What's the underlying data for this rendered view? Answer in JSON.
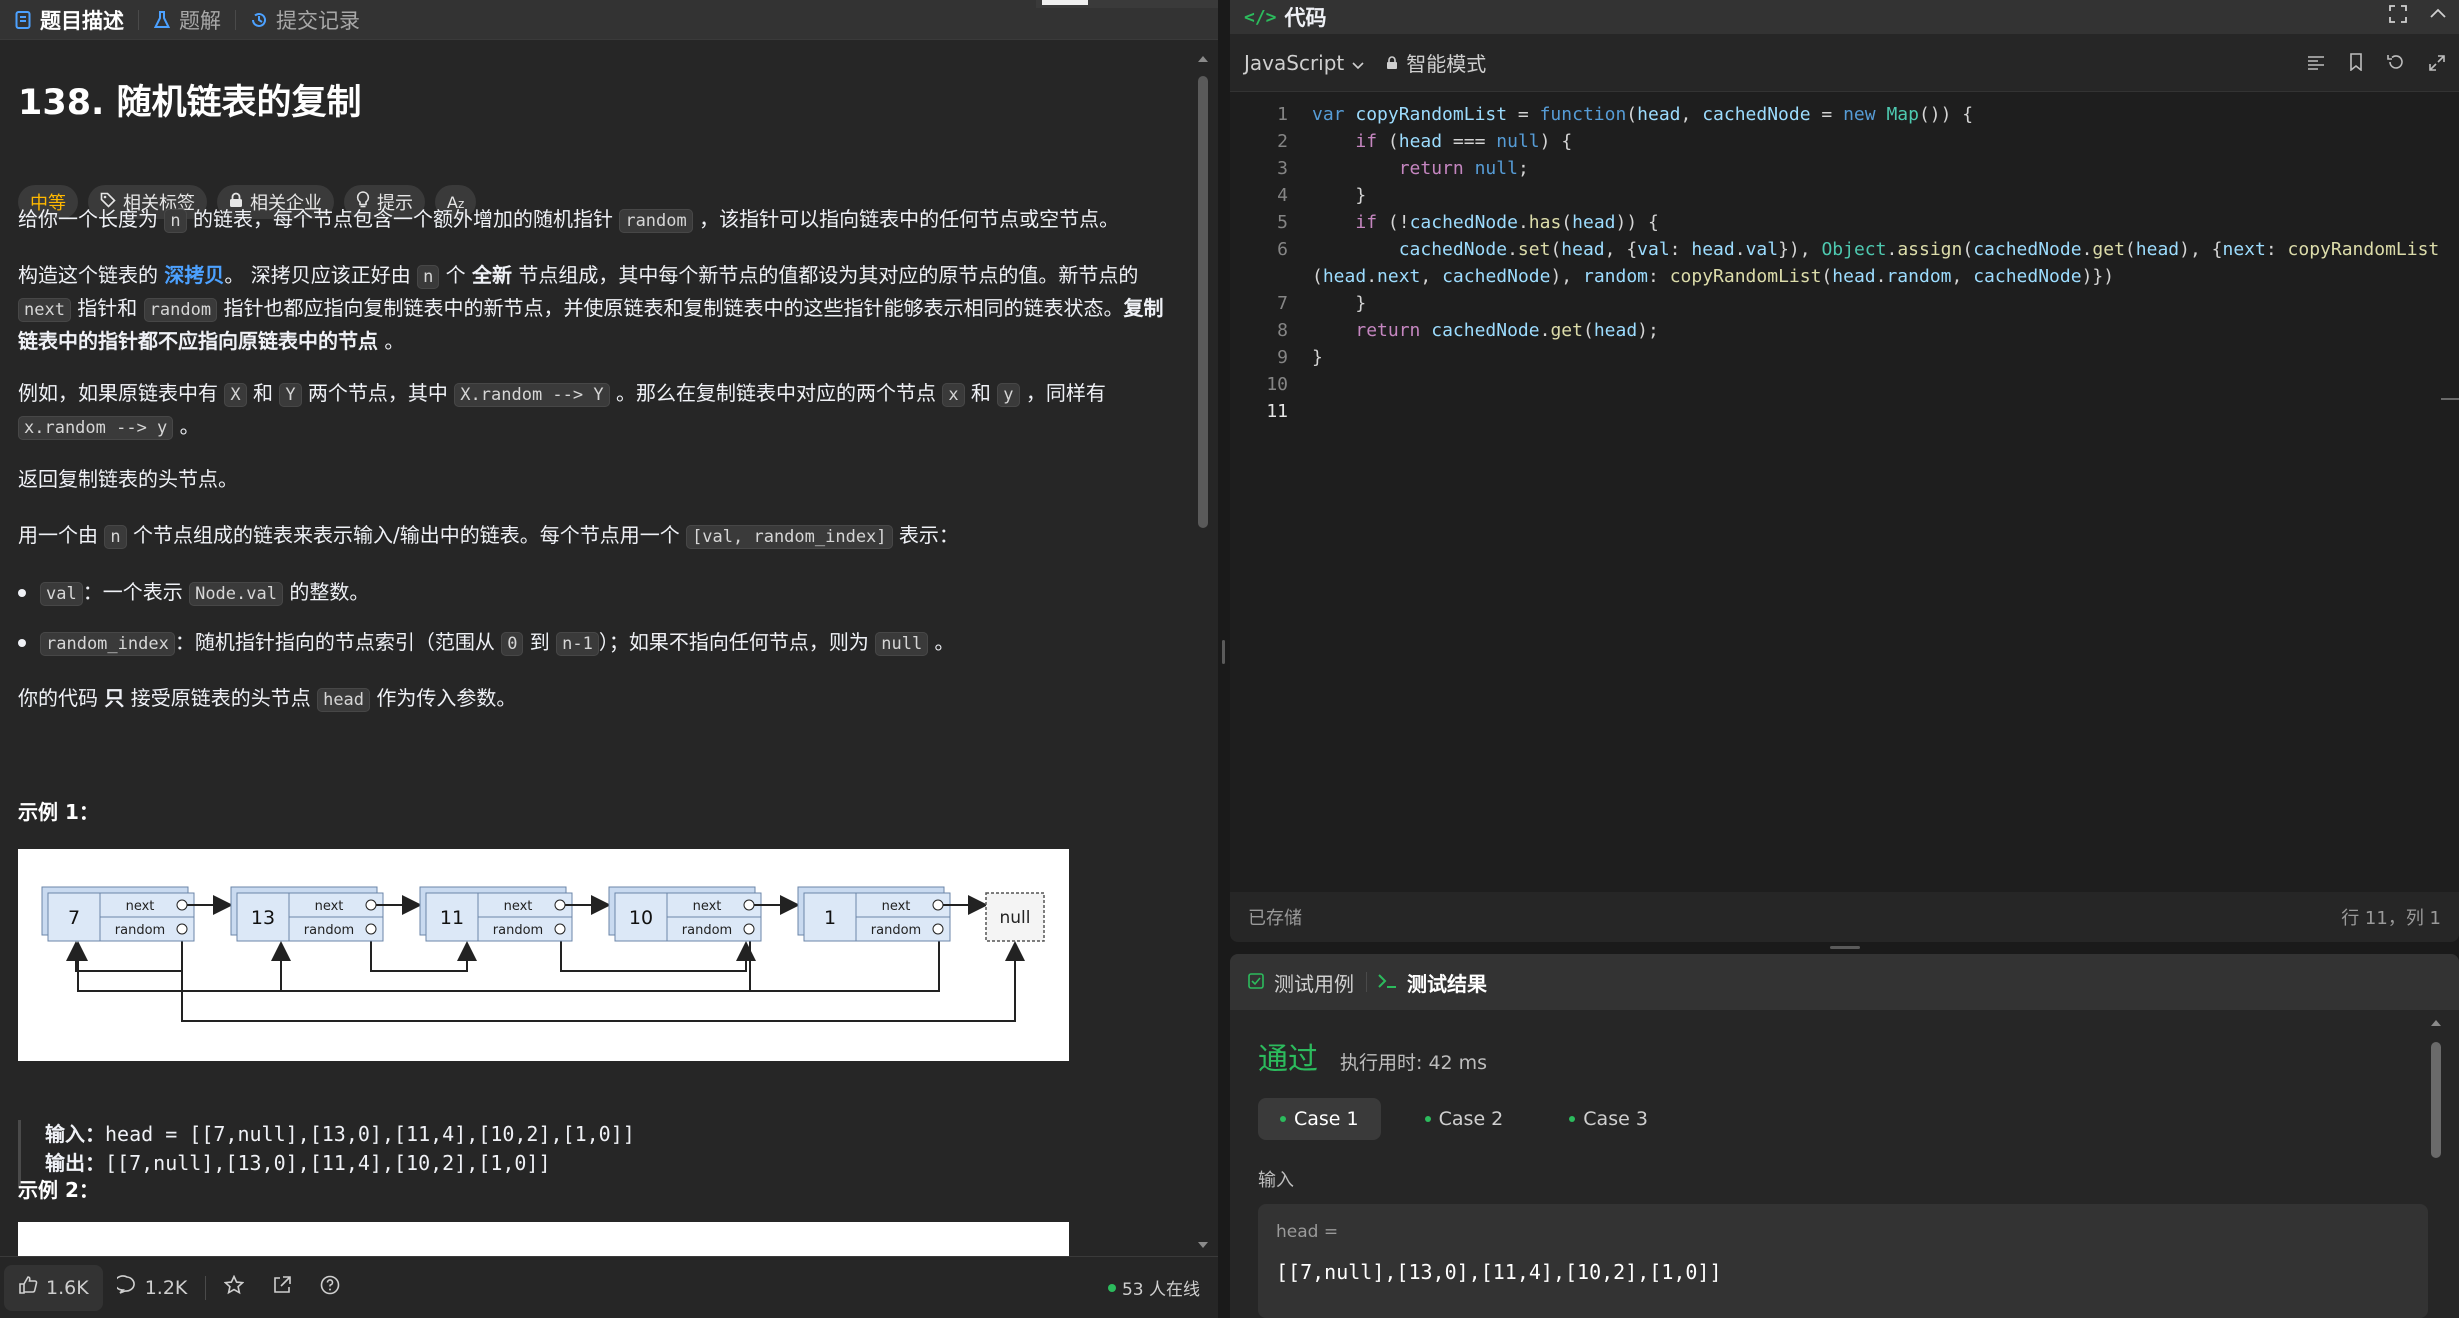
{
  "left_tabs": [
    {
      "label": "题目描述",
      "icon": "doc-icon",
      "color": "#4ca1ff"
    },
    {
      "label": "题解",
      "icon": "flask-icon",
      "color": "#4ca1ff"
    },
    {
      "label": "提交记录",
      "icon": "history-icon",
      "color": "#4ca1ff"
    }
  ],
  "problem": {
    "title": "138. 随机链表的复制",
    "chips": [
      {
        "label": "中等",
        "icon": ""
      },
      {
        "label": "相关标签",
        "icon": "tag-icon"
      },
      {
        "label": "相关企业",
        "icon": "lock-icon"
      },
      {
        "label": "提示",
        "icon": "bulb-icon"
      },
      {
        "label": "",
        "icon": "translate-icon"
      }
    ],
    "p1": {
      "a": "给你一个长度为 ",
      "b": "n",
      "c": " 的链表，每个节点包含一个额外增加的随机指针 ",
      "d": "random",
      "e": " ，该指针可以指向链表中的任何节点或空节点。"
    },
    "p2": {
      "a": "构造这个链表的 ",
      "link": "深拷贝",
      "b": "。 深拷贝应该正好由 ",
      "c": "n",
      "d": " 个 ",
      "e": "全新",
      "f": " 节点组成，其中每个新节点的值都设为其对应的原节点的值。新节点的 ",
      "g": "next",
      "h": " 指针和 ",
      "i": "random",
      "j": " 指针也都应指向复制链表中的新节点，并使原链表和复制链表中的这些指针能够表示相同的链表状态。",
      "k": "复制链表中的指针都不应指向原链表中的节点",
      "l": " 。"
    },
    "p3": {
      "a": "例如，如果原链表中有 ",
      "b": "X",
      "c": " 和 ",
      "d": "Y",
      "e": " 两个节点，其中 ",
      "f": "X.random --> Y",
      "g": " 。那么在复制链表中对应的两个节点 ",
      "h": "x",
      "i": " 和 ",
      "j": "y",
      "k": " ，同样有 ",
      "l": "x.random --> y",
      "m": " 。"
    },
    "p4": "返回复制链表的头节点。",
    "p5": {
      "a": "用一个由 ",
      "b": "n",
      "c": " 个节点组成的链表来表示输入/输出中的链表。每个节点用一个 ",
      "d": "[val, random_index]",
      "e": " 表示："
    },
    "bullet1": {
      "a": "val",
      "b": "：一个表示 ",
      "c": "Node.val",
      "d": " 的整数。"
    },
    "bullet2": {
      "a": "random_index",
      "b": "：随机指针指向的节点索引（范围从 ",
      "c": "0",
      "d": " 到 ",
      "e": "n-1",
      "f": "）；如果不指向任何节点，则为  ",
      "g": "null",
      "h": " 。"
    },
    "p6": {
      "a": "你的代码 ",
      "b": "只",
      "c": " 接受原链表的头节点 ",
      "d": "head",
      "e": " 作为传入参数。"
    },
    "example1": {
      "title": "示例 1：",
      "diagram": {
        "nodes": [
          "7",
          "13",
          "11",
          "10",
          "1"
        ],
        "next_label": "next",
        "random_label": "random",
        "null_label": "null"
      },
      "input_label": "输入：",
      "input": "head = [[7,null],[13,0],[11,4],[10,2],[1,0]]",
      "output_label": "输出：",
      "output": "[[7,null],[13,0],[11,4],[10,2],[1,0]]"
    },
    "example2": {
      "title": "示例 2："
    }
  },
  "footer": {
    "likes": "1.6K",
    "comments": "1.2K",
    "online": "53 人在线"
  },
  "code_panel": {
    "title": "代码",
    "language": "JavaScript",
    "mode": "智能模式",
    "status": "已存储",
    "position": "行 11，列 1",
    "line_numbers": [
      "1",
      "2",
      "3",
      "4",
      "5",
      "6",
      "",
      "7",
      "8",
      "9",
      "10",
      "11"
    ]
  },
  "result_panel": {
    "tabs": [
      "测试用例",
      "测试结果"
    ],
    "verdict": "通过",
    "runtime": "执行用时: 42 ms",
    "cases": [
      "Case 1",
      "Case 2",
      "Case 3"
    ],
    "input_label": "输入",
    "input_var": "head =",
    "input_value": "[[7,null],[13,0],[11,4],[10,2],[1,0]]"
  },
  "colors": {
    "accent_green": "#2cbb5d",
    "link_blue": "#4ca1ff",
    "medium_orange": "#ffb800"
  }
}
